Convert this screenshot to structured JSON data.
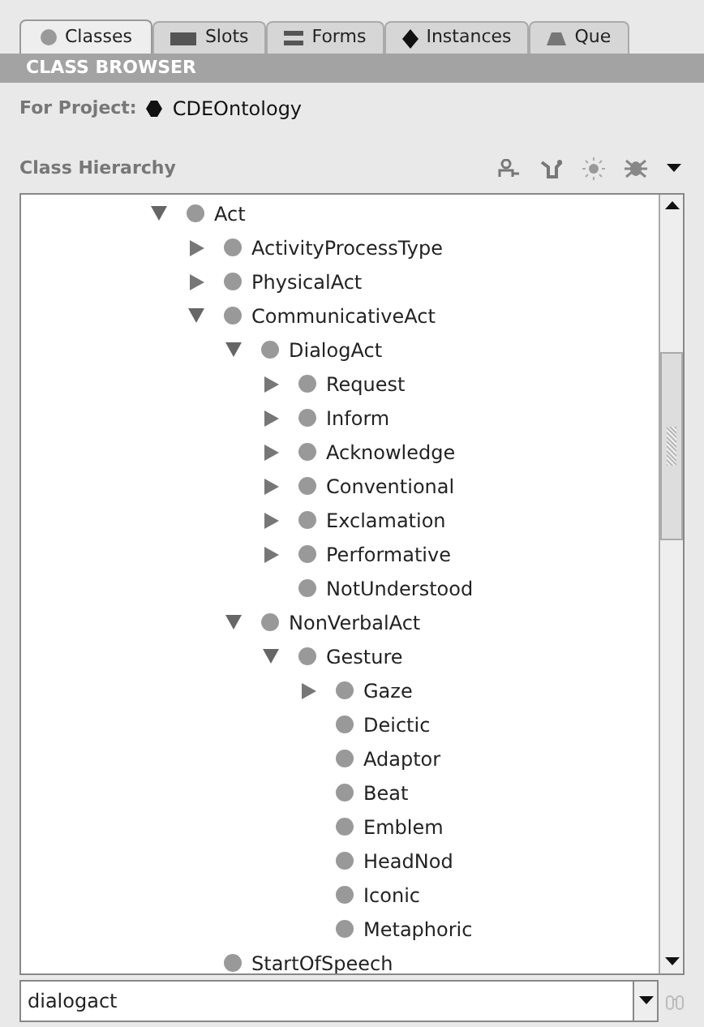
{
  "tabs": [
    {
      "label": "Classes",
      "selected": true
    },
    {
      "label": "Slots",
      "selected": false
    },
    {
      "label": "Forms",
      "selected": false
    },
    {
      "label": "Instances",
      "selected": false
    },
    {
      "label": "Que",
      "selected": false
    }
  ],
  "header": "CLASS BROWSER",
  "project": {
    "label": "For Project:",
    "name": "CDEOntology"
  },
  "hierarchy_title": "Class Hierarchy",
  "tree": [
    {
      "label": "Act",
      "kind": "branch",
      "expanded": true,
      "children": [
        {
          "label": "ActivityProcessType",
          "kind": "branch",
          "expanded": false
        },
        {
          "label": "PhysicalAct",
          "kind": "branch",
          "expanded": false
        },
        {
          "label": "CommunicativeAct",
          "kind": "branch",
          "expanded": true,
          "children": [
            {
              "label": "DialogAct",
              "kind": "branch",
              "expanded": true,
              "children": [
                {
                  "label": "Request",
                  "kind": "branch",
                  "expanded": false
                },
                {
                  "label": "Inform",
                  "kind": "branch",
                  "expanded": false
                },
                {
                  "label": "Acknowledge",
                  "kind": "branch",
                  "expanded": false
                },
                {
                  "label": "Conventional",
                  "kind": "branch",
                  "expanded": false
                },
                {
                  "label": "Exclamation",
                  "kind": "branch",
                  "expanded": false
                },
                {
                  "label": "Performative",
                  "kind": "branch",
                  "expanded": false
                },
                {
                  "label": "NotUnderstood",
                  "kind": "leaf"
                }
              ]
            },
            {
              "label": "NonVerbalAct",
              "kind": "branch",
              "expanded": true,
              "children": [
                {
                  "label": "Gesture",
                  "kind": "branch",
                  "expanded": true,
                  "children": [
                    {
                      "label": "Gaze",
                      "kind": "branch",
                      "expanded": false
                    },
                    {
                      "label": "Deictic",
                      "kind": "leaf"
                    },
                    {
                      "label": "Adaptor",
                      "kind": "leaf"
                    },
                    {
                      "label": "Beat",
                      "kind": "leaf"
                    },
                    {
                      "label": "Emblem",
                      "kind": "leaf"
                    },
                    {
                      "label": "HeadNod",
                      "kind": "leaf"
                    },
                    {
                      "label": "Iconic",
                      "kind": "leaf"
                    },
                    {
                      "label": "Metaphoric",
                      "kind": "leaf"
                    }
                  ]
                }
              ]
            }
          ]
        },
        {
          "label": "StartOfSpeech",
          "kind": "leaf"
        }
      ]
    }
  ],
  "search": {
    "value": "dialogact"
  }
}
